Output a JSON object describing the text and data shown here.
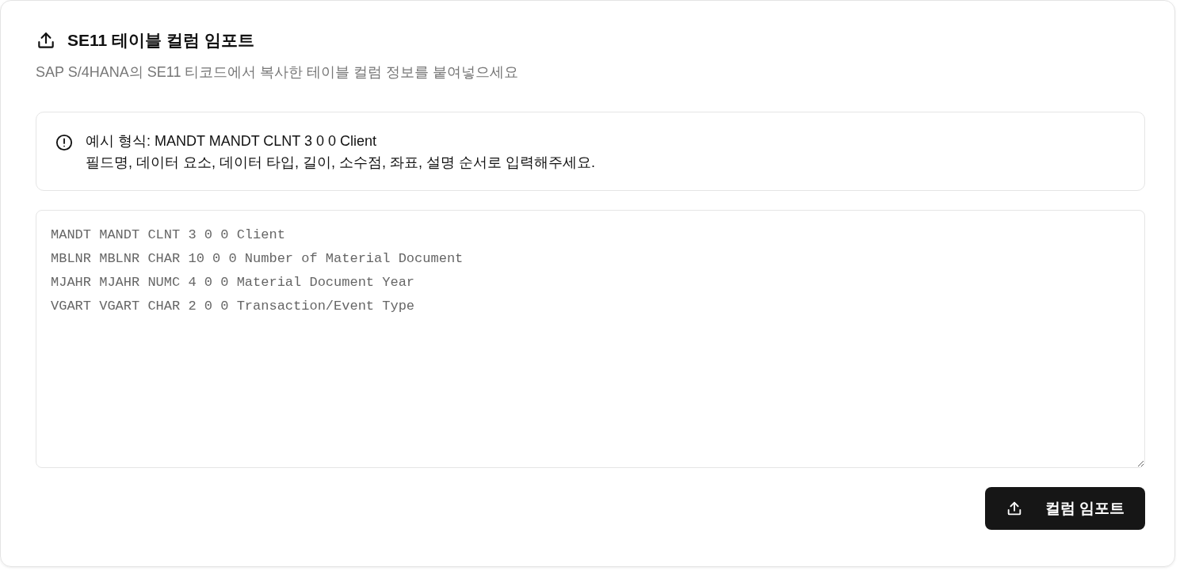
{
  "card": {
    "title": "SE11 테이블 컬럼 임포트",
    "subtitle": "SAP S/4HANA의 SE11 티코드에서 복사한 테이블 컬럼 정보를 붙여넣으세요"
  },
  "notice": {
    "lines": [
      "예시 형식: MANDT MANDT CLNT 3 0 0 Client",
      "필드명, 데이터 요소, 데이터 타입, 길이, 소수점, 좌표, 설명 순서로 입력해주세요."
    ]
  },
  "input": {
    "value_lines": [
      "MANDT MANDT CLNT 3 0 0 Client",
      "MBLNR MBLNR CHAR 10 0 0 Number of Material Document",
      "MJAHR MJAHR NUMC 4 0 0 Material Document Year",
      "VGART VGART CHAR 2 0 0 Transaction/Event Type"
    ]
  },
  "import_button": {
    "label": "컬럼 임포트"
  }
}
